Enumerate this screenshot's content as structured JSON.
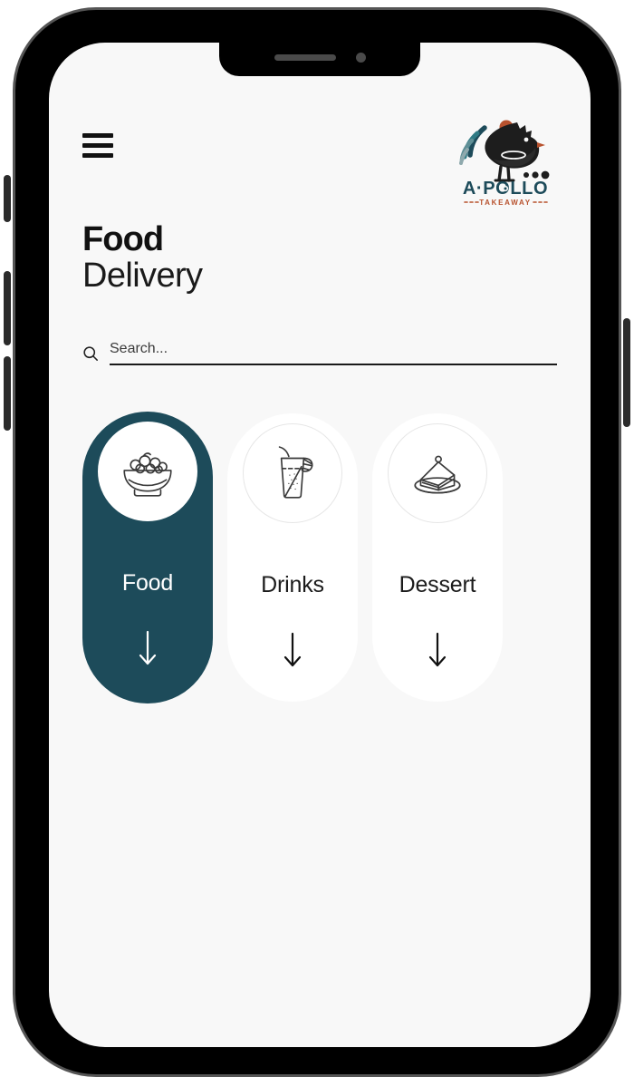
{
  "device": {
    "type": "smartphone-mockup",
    "notch": {
      "speaker": "earpiece-speaker",
      "camera": "front-camera"
    },
    "buttons": [
      "silent-switch",
      "volume-up",
      "volume-down",
      "power"
    ]
  },
  "colors": {
    "screen_background": "#f8f8f8",
    "active_card": "#1d4b5a",
    "card": "#ffffff",
    "text": "#111111",
    "logo_teal": "#1d4b5a",
    "logo_rust": "#b8522e",
    "frame": "#000000",
    "frame_edge": "#555555"
  },
  "header": {
    "menu_icon": "hamburger-menu-icon",
    "logo": {
      "name": "apollo-takeaway-logo",
      "brand": "A-POLLO",
      "tagline": "TAKEAWAY",
      "mark": "rooster-illustration"
    }
  },
  "title": {
    "line1": "Food",
    "line2": "Delivery"
  },
  "search": {
    "icon": "search-icon",
    "placeholder": "Search...",
    "value": ""
  },
  "categories": [
    {
      "label": "Food",
      "icon": "salad-bowl-icon",
      "arrow": "arrow-down-icon",
      "active": true
    },
    {
      "label": "Drinks",
      "icon": "drink-glass-icon",
      "arrow": "arrow-down-icon",
      "active": false
    },
    {
      "label": "Dessert",
      "icon": "cake-slice-icon",
      "arrow": "arrow-down-icon",
      "active": false
    }
  ]
}
